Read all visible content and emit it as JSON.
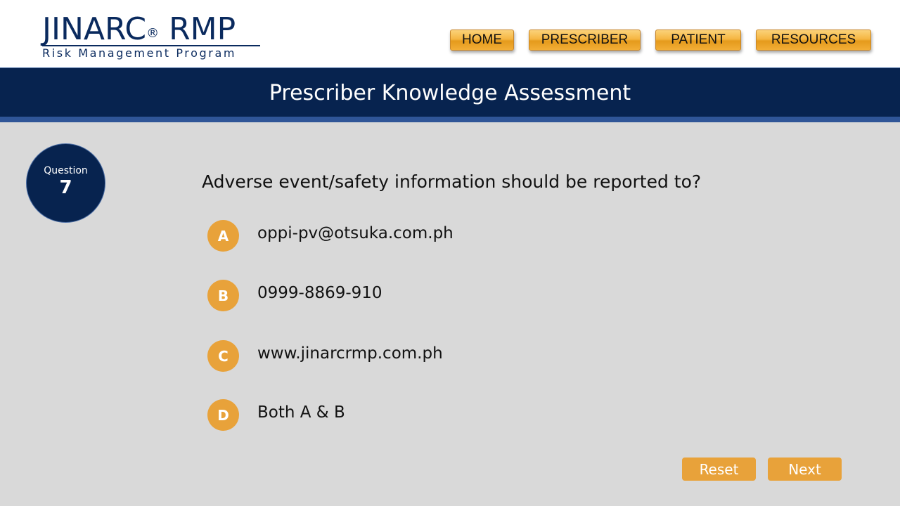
{
  "logo": {
    "title": "JINARC",
    "registered": "®",
    "title_suffix": "RMP",
    "subtitle": "Risk Management Program"
  },
  "nav": {
    "items": [
      {
        "label": "HOME"
      },
      {
        "label": "PRESCRIBER"
      },
      {
        "label": "PATIENT"
      },
      {
        "label": "RESOURCES"
      }
    ]
  },
  "banner": {
    "title": "Prescriber Knowledge Assessment"
  },
  "question": {
    "label": "Question",
    "number": "7",
    "text": "Adverse event/safety information should be reported to?"
  },
  "options": [
    {
      "letter": "A",
      "text": "oppi-pv@otsuka.com.ph"
    },
    {
      "letter": "B",
      "text": "0999-8869-910"
    },
    {
      "letter": "C",
      "text": "www.jinarcrmp.com.ph"
    },
    {
      "letter": "D",
      "text": "Both A & B"
    }
  ],
  "actions": {
    "reset_label": "Reset",
    "next_label": "Next"
  },
  "colors": {
    "navy": "#07234f",
    "accent_blue": "#2f5597",
    "orange": "#e8a23a",
    "background": "#d9d9d9"
  }
}
